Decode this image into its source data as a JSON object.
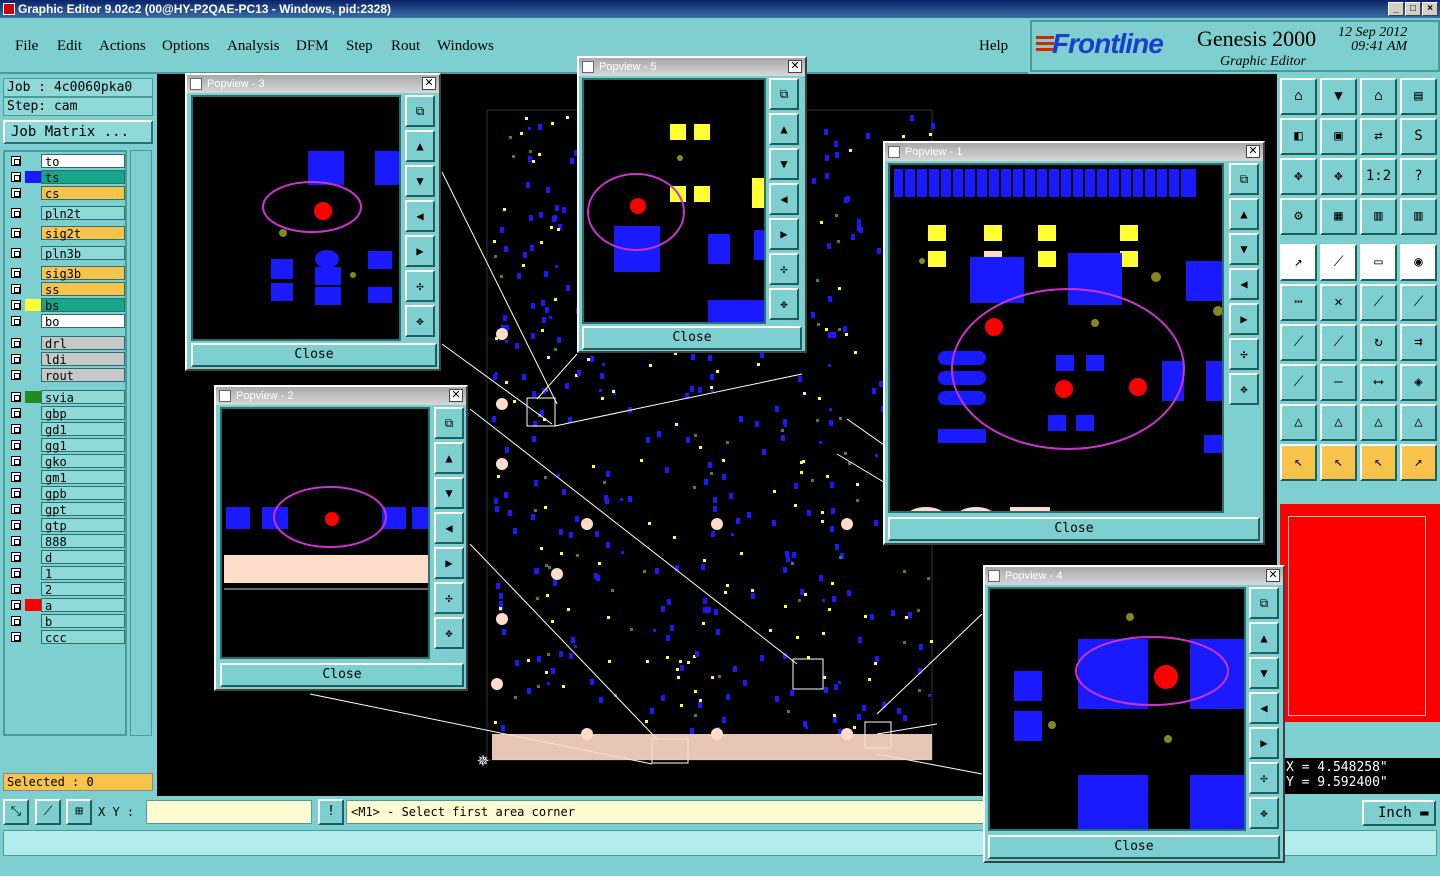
{
  "window": {
    "title": "Graphic Editor 9.02c2 (00@HY-P2QAE-PC13 - Windows, pid:2328)",
    "min": "_",
    "max": "□",
    "close": "×"
  },
  "menu": {
    "items": [
      "File",
      "Edit",
      "Actions",
      "Options",
      "Analysis",
      "DFM",
      "Step",
      "Rout",
      "Windows"
    ],
    "help": "Help"
  },
  "brand": {
    "logo": "Frontline",
    "product": "Genesis 2000",
    "subtitle": "Graphic Editor",
    "date_line1": "12 Sep 2012",
    "date_line2": "09:41 AM"
  },
  "job": {
    "job_label": "Job : 4c0060pka0",
    "step_label": "Step: cam",
    "matrix_button": "Job Matrix ..."
  },
  "layers": [
    {
      "name": "to",
      "bg": "#ffffff",
      "swatch": ""
    },
    {
      "name": "ts",
      "bg": "#17a589",
      "swatch": "#1a1aff"
    },
    {
      "name": "cs",
      "bg": "#f7c34a",
      "swatch": ""
    },
    {
      "name": "pln2t",
      "bg": "#8fd9d9",
      "swatch": ""
    },
    {
      "name": "sig2t",
      "bg": "#f7c34a",
      "swatch": ""
    },
    {
      "name": "pln3b",
      "bg": "#8fd9d9",
      "swatch": ""
    },
    {
      "name": "sig3b",
      "bg": "#f7c34a",
      "swatch": ""
    },
    {
      "name": "ss",
      "bg": "#f7c34a",
      "swatch": ""
    },
    {
      "name": "bs",
      "bg": "#17a589",
      "swatch": "#ffff33"
    },
    {
      "name": "bo",
      "bg": "#ffffff",
      "swatch": ""
    },
    {
      "name": "drl",
      "bg": "#c8c8c8",
      "swatch": ""
    },
    {
      "name": "ldi",
      "bg": "#c8c8c8",
      "swatch": ""
    },
    {
      "name": "rout",
      "bg": "#c8c8c8",
      "swatch": ""
    },
    {
      "name": "svia",
      "bg": "#8fd9d9",
      "swatch": "#1e8c1e"
    },
    {
      "name": "gbp",
      "bg": "#8fd9d9",
      "swatch": ""
    },
    {
      "name": "gd1",
      "bg": "#8fd9d9",
      "swatch": ""
    },
    {
      "name": "gg1",
      "bg": "#8fd9d9",
      "swatch": ""
    },
    {
      "name": "gko",
      "bg": "#8fd9d9",
      "swatch": ""
    },
    {
      "name": "gm1",
      "bg": "#8fd9d9",
      "swatch": ""
    },
    {
      "name": "gpb",
      "bg": "#8fd9d9",
      "swatch": ""
    },
    {
      "name": "gpt",
      "bg": "#8fd9d9",
      "swatch": ""
    },
    {
      "name": "gtp",
      "bg": "#8fd9d9",
      "swatch": ""
    },
    {
      "name": "888",
      "bg": "#8fd9d9",
      "swatch": ""
    },
    {
      "name": "d",
      "bg": "#8fd9d9",
      "swatch": ""
    },
    {
      "name": "1",
      "bg": "#8fd9d9",
      "swatch": ""
    },
    {
      "name": "2",
      "bg": "#8fd9d9",
      "swatch": ""
    },
    {
      "name": "a",
      "bg": "#8fd9d9",
      "swatch": "#ff0000"
    },
    {
      "name": "b",
      "bg": "#8fd9d9",
      "swatch": ""
    },
    {
      "name": "ccc",
      "bg": "#8fd9d9",
      "swatch": ""
    }
  ],
  "selected": "Selected : 0",
  "popups": [
    {
      "title": "Popview - 3",
      "close_label": "Close"
    },
    {
      "title": "Popview - 5",
      "close_label": "Close"
    },
    {
      "title": "Popview - 1",
      "close_label": "Close"
    },
    {
      "title": "Popview - 2",
      "close_label": "Close"
    },
    {
      "title": "Popview - 4",
      "close_label": "Close"
    }
  ],
  "status": {
    "xy_label": "X Y :",
    "xy_value": "",
    "message": "<M1> - Select first area corner",
    "units": "Inch",
    "info": "!"
  },
  "coords": {
    "x": "X = 4.548258\"",
    "y": "Y = 9.592400\""
  },
  "tool_icons": [
    "home-icon",
    "save-icon",
    "step-icon",
    "panel-icon",
    "zoom-in-icon",
    "zoom-out-icon",
    "flip-icon",
    "snap-icon",
    "fit-icon",
    "center-icon",
    "scale-icon",
    "help-icon",
    "ruler-icon",
    "grid-icon",
    "layer-icon",
    "layer2-icon"
  ],
  "colors": {
    "board": "#000000",
    "pad_blue": "#1a1aff",
    "pad_yellow": "#ffff33",
    "pad_red": "#ff0000",
    "highlight": "#cc33cc",
    "panel": "#7ecfcf"
  }
}
